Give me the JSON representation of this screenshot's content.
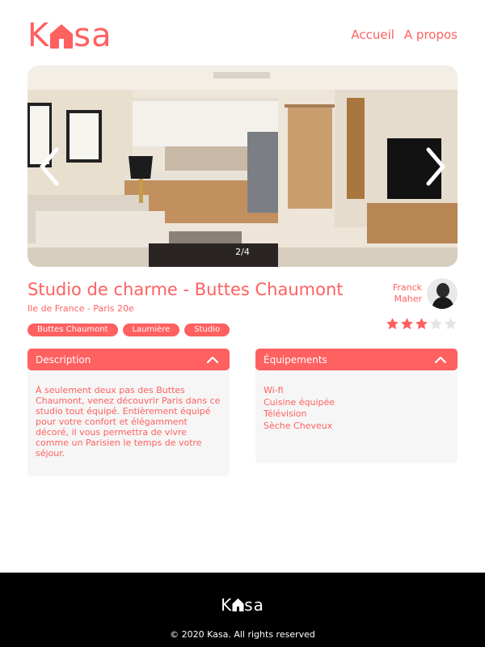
{
  "header": {
    "logo_prefix": "K",
    "logo_suffix": "sa",
    "nav": [
      "Accueil",
      "A propos"
    ]
  },
  "gallery": {
    "current": 2,
    "total": 4,
    "counter": "2/4"
  },
  "listing": {
    "title": "Studio de charme - Buttes Chaumont",
    "location": "Ile de France - Paris 20e",
    "tags": [
      "Buttes Chaumont",
      "Laumière",
      "Studio"
    ],
    "host": {
      "first": "Franck",
      "last": "Maher"
    },
    "rating": 3,
    "rating_max": 5
  },
  "description": {
    "title": "Description",
    "text": "À seulement deux pas des Buttes Chaumont, venez découvrir Paris dans ce studio tout équipé. Entièrement équipé pour votre confort et élégamment décoré, il vous permettra de vivre comme un Parisien le temps de votre séjour."
  },
  "equipments": {
    "title": "Équipements",
    "items": [
      "Wi-fi",
      "Cuisine équipée",
      "Télévision",
      "Sèche Cheveux"
    ]
  },
  "footer": {
    "logo_prefix": "K",
    "logo_suffix": "sa",
    "copyright": "© 2020 Kasa. All rights reserved"
  },
  "colors": {
    "accent": "#FF6060",
    "panel": "#F6F6F6",
    "footer": "#000000"
  }
}
